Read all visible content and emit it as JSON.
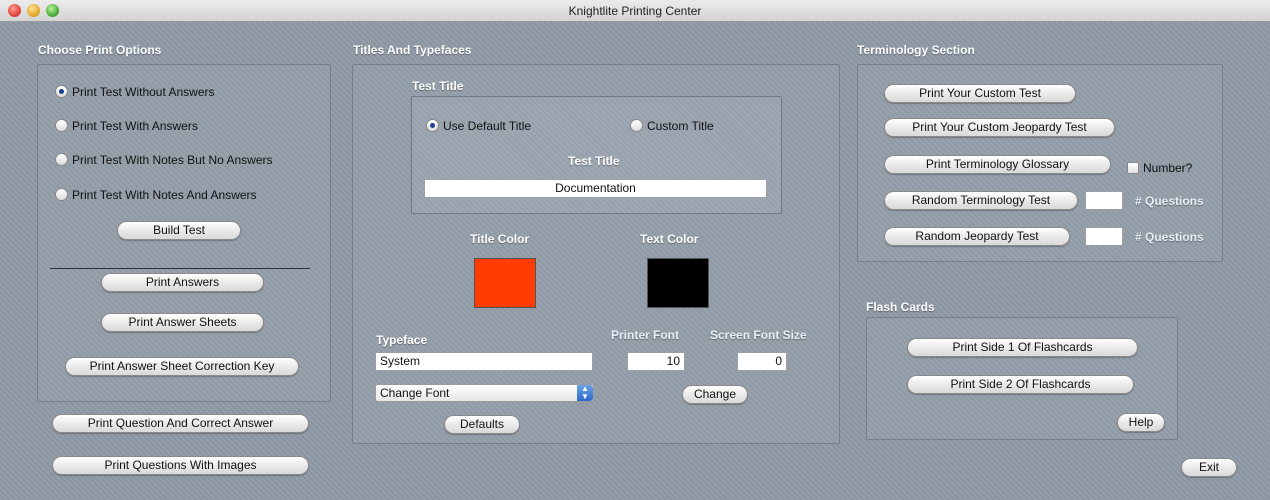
{
  "window": {
    "title": "Knightlite Printing Center"
  },
  "print_options": {
    "section_title": "Choose Print Options",
    "radios": [
      {
        "label": "Print Test Without Answers",
        "selected": true
      },
      {
        "label": "Print Test With Answers",
        "selected": false
      },
      {
        "label": "Print Test With Notes But No Answers",
        "selected": false
      },
      {
        "label": "Print Test With Notes And Answers",
        "selected": false
      }
    ],
    "build_test": "Build Test",
    "print_answers": "Print Answers",
    "print_answer_sheets": "Print Answer Sheets",
    "print_answer_sheet_key": "Print Answer Sheet Correction Key",
    "print_question_answer": "Print Question And Correct Answer",
    "print_questions_images": "Print Questions With Images"
  },
  "titles": {
    "section_title": "Titles And Typefaces",
    "test_title_group": "Test Title",
    "radio_default": {
      "label": "Use Default Title",
      "selected": true
    },
    "radio_custom": {
      "label": "Custom Title",
      "selected": false
    },
    "test_title_label": "Test Title",
    "test_title_value": "Documentation",
    "title_color_label": "Title Color",
    "text_color_label": "Text  Color",
    "title_color": "#ff3d00",
    "text_color": "#000000",
    "typeface_label": "Typeface",
    "typeface_value": "System",
    "printer_font_label": "Printer Font",
    "printer_font_value": "10",
    "screen_font_size_label": "Screen Font Size",
    "screen_font_size_value": "0",
    "change_font_select": "Change Font",
    "change_button": "Change",
    "defaults_button": "Defaults"
  },
  "terminology": {
    "section_title": "Terminology Section",
    "print_custom_test": "Print Your Custom Test",
    "print_custom_jeopardy": "Print Your Custom Jeopardy Test",
    "print_glossary": "Print Terminology Glossary",
    "number_checkbox": "Number?",
    "random_term_test": "Random Terminology Test",
    "random_jeopardy_test": "Random Jeopardy Test",
    "questions_label_1": "# Questions",
    "questions_label_2": "# Questions"
  },
  "flash_cards": {
    "section_title": "Flash Cards",
    "print_side1": "Print Side 1 Of Flashcards",
    "print_side2": "Print Side 2 Of Flashcards",
    "help": "Help"
  },
  "exit_button": "Exit"
}
